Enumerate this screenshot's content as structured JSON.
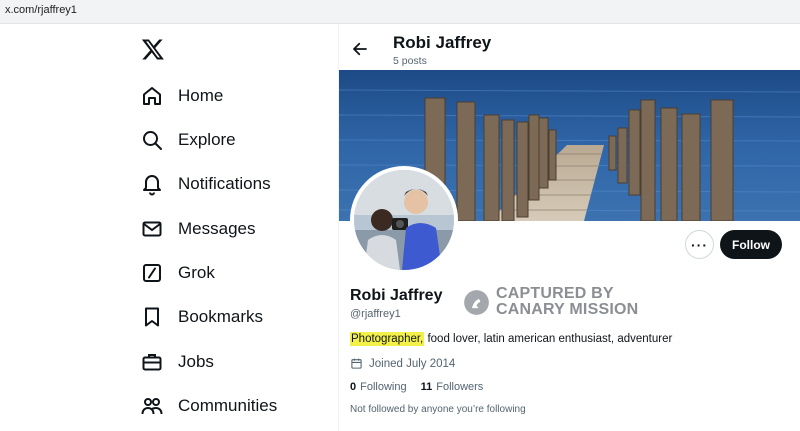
{
  "browser": {
    "url": "x.com/rjaffrey1"
  },
  "sidebar": {
    "logo": "x-logo-icon",
    "items": [
      {
        "label": "Home",
        "icon": "home-icon"
      },
      {
        "label": "Explore",
        "icon": "search-icon"
      },
      {
        "label": "Notifications",
        "icon": "bell-icon"
      },
      {
        "label": "Messages",
        "icon": "envelope-icon"
      },
      {
        "label": "Grok",
        "icon": "grok-icon"
      },
      {
        "label": "Bookmarks",
        "icon": "bookmark-icon"
      },
      {
        "label": "Jobs",
        "icon": "briefcase-icon"
      },
      {
        "label": "Communities",
        "icon": "people-icon"
      }
    ]
  },
  "header": {
    "name": "Robi Jaffrey",
    "posts": "5 posts"
  },
  "profile": {
    "name": "Robi Jaffrey",
    "handle": "@rjaffrey1",
    "bio_highlight": "Photographer,",
    "bio_rest": " food lover, latin american enthusiast, adventurer",
    "joined": "Joined July 2014",
    "following_count": "0",
    "following_label": "Following",
    "followers_count": "11",
    "followers_label": "Followers",
    "not_followed": "Not followed by anyone you’re following",
    "more_label": "···",
    "follow_label": "Follow"
  },
  "watermark": {
    "line1": "CAPTURED BY",
    "line2": "CANARY MISSION"
  },
  "colors": {
    "accent": "#0f1419",
    "highlight": "#f4f04a",
    "muted": "#536471"
  }
}
